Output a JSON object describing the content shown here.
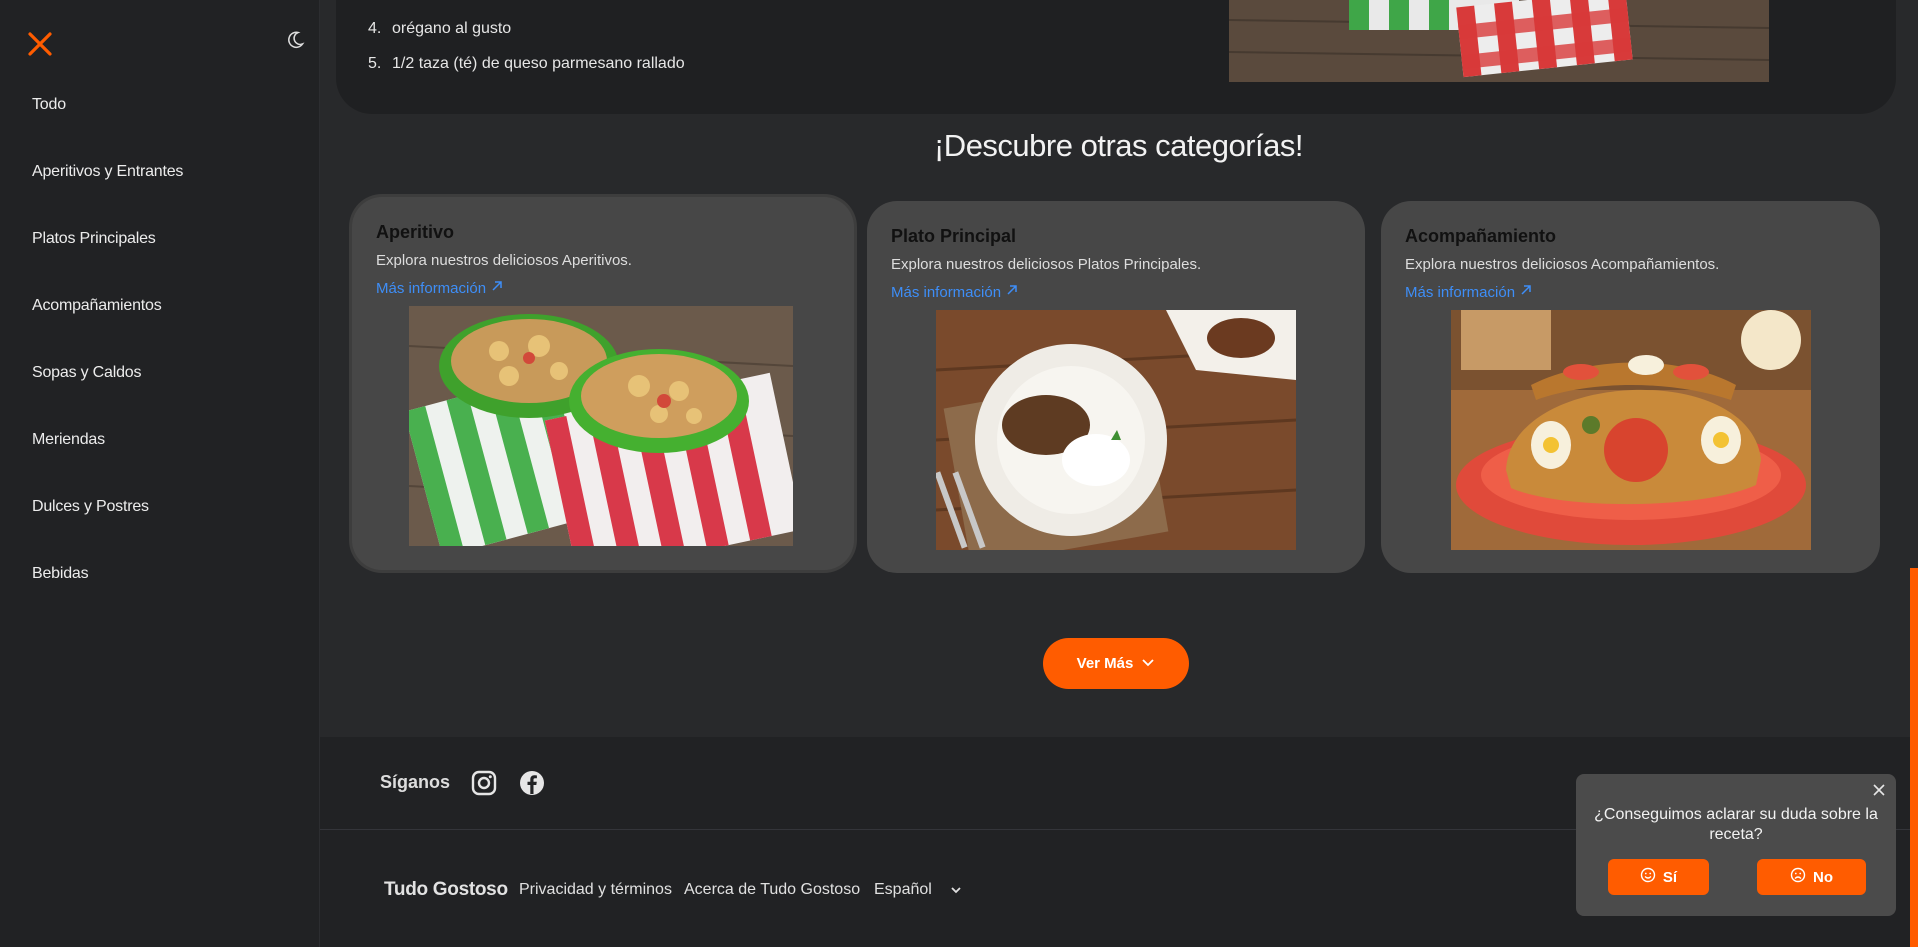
{
  "sidebar": {
    "items": [
      {
        "label": "Todo"
      },
      {
        "label": "Aperitivos y Entrantes"
      },
      {
        "label": "Platos Principales"
      },
      {
        "label": "Acompañamientos"
      },
      {
        "label": "Sopas y Caldos"
      },
      {
        "label": "Meriendas"
      },
      {
        "label": "Dulces y Postres"
      },
      {
        "label": "Bebidas"
      }
    ],
    "accent": "#ff5c00"
  },
  "ingredients": [
    {
      "num": "4.",
      "text": "orégano al gusto"
    },
    {
      "num": "5.",
      "text": "1/2 taza (té) de queso parmesano rallado"
    }
  ],
  "categories_section": {
    "title": "¡Descubre otras categorías!",
    "cards": [
      {
        "title": "Aperitivo",
        "desc": "Explora nuestros deliciosos Aperitivos.",
        "link": "Más información"
      },
      {
        "title": "Plato Principal",
        "desc": "Explora nuestros deliciosos Platos Principales.",
        "link": "Más información"
      },
      {
        "title": "Acompañamiento",
        "desc": "Explora nuestros deliciosos Acompañamientos.",
        "link": "Más información"
      }
    ],
    "more_button": "Ver Más"
  },
  "footer": {
    "follow_label": "Síganos",
    "brand": "Tudo Gostoso",
    "links": [
      "Privacidad y términos",
      "Acerca de Tudo Gostoso"
    ],
    "language": "Español"
  },
  "feedback": {
    "question": "¿Conseguimos aclarar su duda sobre la receta?",
    "yes": "Sí",
    "no": "No"
  },
  "icons": [
    "close-icon",
    "moon-icon",
    "arrow-up-right-icon",
    "chevron-down-icon",
    "instagram-icon",
    "facebook-icon",
    "smile-icon",
    "frown-icon"
  ]
}
